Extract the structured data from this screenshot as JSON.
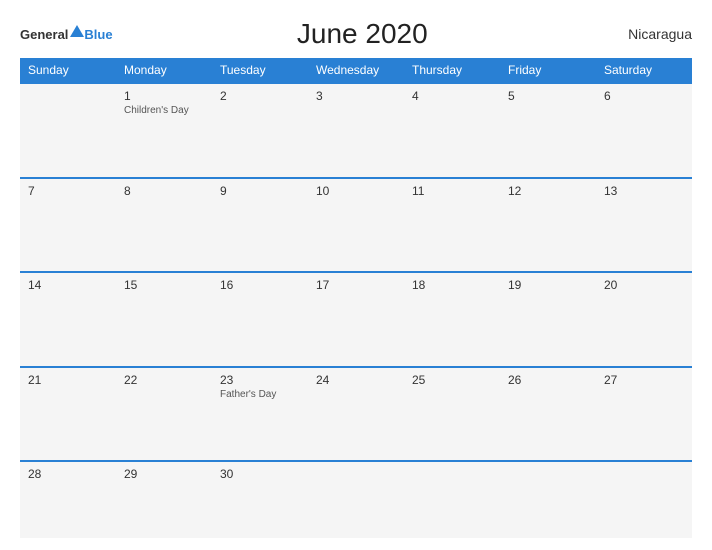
{
  "header": {
    "logo_general": "General",
    "logo_blue": "Blue",
    "title": "June 2020",
    "country": "Nicaragua"
  },
  "calendar": {
    "days_of_week": [
      "Sunday",
      "Monday",
      "Tuesday",
      "Wednesday",
      "Thursday",
      "Friday",
      "Saturday"
    ],
    "weeks": [
      [
        {
          "day": "",
          "holiday": ""
        },
        {
          "day": "1",
          "holiday": "Children's Day"
        },
        {
          "day": "2",
          "holiday": ""
        },
        {
          "day": "3",
          "holiday": ""
        },
        {
          "day": "4",
          "holiday": ""
        },
        {
          "day": "5",
          "holiday": ""
        },
        {
          "day": "6",
          "holiday": ""
        }
      ],
      [
        {
          "day": "7",
          "holiday": ""
        },
        {
          "day": "8",
          "holiday": ""
        },
        {
          "day": "9",
          "holiday": ""
        },
        {
          "day": "10",
          "holiday": ""
        },
        {
          "day": "11",
          "holiday": ""
        },
        {
          "day": "12",
          "holiday": ""
        },
        {
          "day": "13",
          "holiday": ""
        }
      ],
      [
        {
          "day": "14",
          "holiday": ""
        },
        {
          "day": "15",
          "holiday": ""
        },
        {
          "day": "16",
          "holiday": ""
        },
        {
          "day": "17",
          "holiday": ""
        },
        {
          "day": "18",
          "holiday": ""
        },
        {
          "day": "19",
          "holiday": ""
        },
        {
          "day": "20",
          "holiday": ""
        }
      ],
      [
        {
          "day": "21",
          "holiday": ""
        },
        {
          "day": "22",
          "holiday": ""
        },
        {
          "day": "23",
          "holiday": "Father's Day"
        },
        {
          "day": "24",
          "holiday": ""
        },
        {
          "day": "25",
          "holiday": ""
        },
        {
          "day": "26",
          "holiday": ""
        },
        {
          "day": "27",
          "holiday": ""
        }
      ],
      [
        {
          "day": "28",
          "holiday": ""
        },
        {
          "day": "29",
          "holiday": ""
        },
        {
          "day": "30",
          "holiday": ""
        },
        {
          "day": "",
          "holiday": ""
        },
        {
          "day": "",
          "holiday": ""
        },
        {
          "day": "",
          "holiday": ""
        },
        {
          "day": "",
          "holiday": ""
        }
      ]
    ]
  }
}
